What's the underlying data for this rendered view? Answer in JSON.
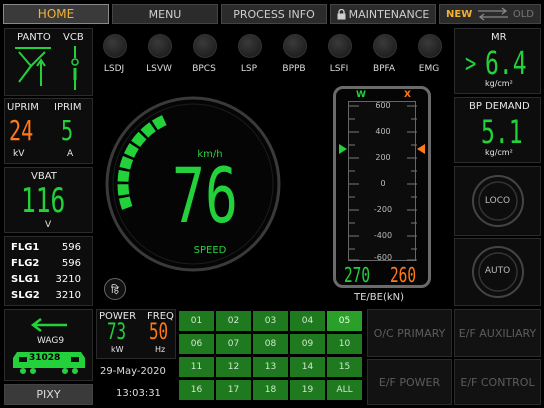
{
  "topbar": {
    "home": "HOME",
    "menu": "MENU",
    "process_info": "PROCESS INFO",
    "maintenance": "MAINTENANCE",
    "new": "NEW",
    "old": "OLD"
  },
  "panto": {
    "label": "PANTO",
    "vcb": "VCB"
  },
  "uprim": {
    "label": "UPRIM",
    "value": "24",
    "unit": "kV"
  },
  "iprim": {
    "label": "IPRIM",
    "value": "5",
    "unit": "A"
  },
  "vbat": {
    "label": "VBAT",
    "value": "116",
    "unit": "V"
  },
  "lamps": [
    "LSDJ",
    "LSVW",
    "BPCS",
    "LSP",
    "BPPB",
    "LSFI",
    "BPFA",
    "EMG"
  ],
  "flags": [
    {
      "name": "FLG1",
      "value": "596"
    },
    {
      "name": "FLG2",
      "value": "596"
    },
    {
      "name": "SLG1",
      "value": "3210"
    },
    {
      "name": "SLG2",
      "value": "3210"
    }
  ],
  "speedometer": {
    "unit": "km/h",
    "value": "76",
    "label": "SPEED",
    "fill_fraction": 0.38,
    "symbol": "हि"
  },
  "tebe": {
    "w": "W",
    "x": "X",
    "scale": [
      "600",
      "400",
      "200",
      "0",
      "-200",
      "-400",
      "-600"
    ],
    "value_w": "270",
    "value_x": "260",
    "label": "TE/BE(kN)"
  },
  "mr": {
    "label": "MR",
    "prefix": ">",
    "value": "6.4",
    "unit": "kg/cm²"
  },
  "bp_demand": {
    "label": "BP DEMAND",
    "value": "5.1",
    "unit": "kg/cm²"
  },
  "right_buttons": {
    "loco": "LOCO",
    "auto": "AUTO"
  },
  "loco": {
    "name": "WAG9",
    "number": "31028"
  },
  "pixy": "PIXY",
  "power": {
    "label": "POWER",
    "value": "73",
    "unit": "kW"
  },
  "freq": {
    "label": "FREQ",
    "value": "50",
    "unit": "Hz"
  },
  "date": "29-May-2020",
  "time": "13:03:31",
  "grid": [
    [
      "01",
      "02",
      "03",
      "04",
      "05"
    ],
    [
      "06",
      "07",
      "08",
      "09",
      "10"
    ],
    [
      "11",
      "12",
      "13",
      "14",
      "15"
    ],
    [
      "16",
      "17",
      "18",
      "19",
      "ALL"
    ]
  ],
  "fault_buttons": [
    "O/C PRIMARY",
    "E/F AUXILIARY",
    "E/F POWER",
    "E/F CONTROL"
  ],
  "colors": {
    "green": "#23d23b",
    "orange": "#ff7a1a",
    "home": "#f2b233"
  }
}
